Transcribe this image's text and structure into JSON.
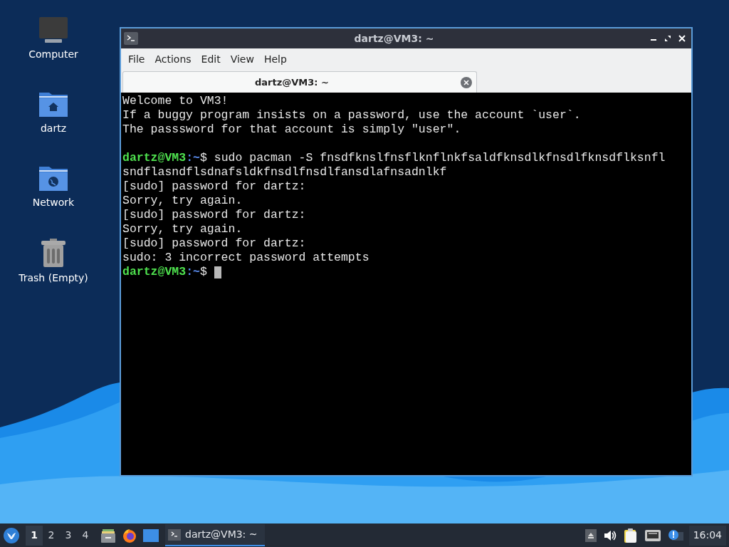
{
  "desktop_icons": [
    {
      "kind": "computer",
      "label": "Computer"
    },
    {
      "kind": "home",
      "label": "dartz"
    },
    {
      "kind": "network",
      "label": "Network"
    },
    {
      "kind": "trash",
      "label": "Trash (Empty)"
    }
  ],
  "window": {
    "title": "dartz@VM3: ~",
    "active": true,
    "menu": [
      "File",
      "Actions",
      "Edit",
      "View",
      "Help"
    ],
    "tabs": [
      {
        "label": "dartz@VM3: ~",
        "selected": true
      }
    ],
    "terminal": [
      {
        "kind": "output",
        "text": "Welcome to VM3!"
      },
      {
        "kind": "output",
        "text": "If a buggy program insists on a password, use the account `user`."
      },
      {
        "kind": "output",
        "text": "The passsword for that account is simply \"user\"."
      },
      {
        "kind": "blank"
      },
      {
        "kind": "prompt",
        "user": "dartz@VM3",
        "path": ":~",
        "command": "$ sudo pacman -S fnsdfknslfnsflknflnkfsaldfknsdlkfnsdlfknsdflksnfl",
        "cursor": false
      },
      {
        "kind": "output",
        "text": "sndflasndflsdnafsldkfnsdlfnsdlfansdlafnsadnlkf"
      },
      {
        "kind": "output",
        "text": "[sudo] password for dartz:"
      },
      {
        "kind": "output",
        "text": "Sorry, try again."
      },
      {
        "kind": "output",
        "text": "[sudo] password for dartz:"
      },
      {
        "kind": "output",
        "text": "Sorry, try again."
      },
      {
        "kind": "output",
        "text": "[sudo] password for dartz:"
      },
      {
        "kind": "output",
        "text": "sudo: 3 incorrect password attempts"
      },
      {
        "kind": "prompt",
        "user": "dartz@VM3",
        "path": ":~",
        "command": "$ ",
        "cursor": true
      }
    ]
  },
  "taskbar": {
    "workspaces": [
      {
        "label": "1",
        "selected": true
      },
      {
        "label": "2",
        "selected": false
      },
      {
        "label": "3",
        "selected": false
      },
      {
        "label": "4",
        "selected": false
      }
    ],
    "launchers": [
      {
        "kind": "files"
      },
      {
        "kind": "browser"
      },
      {
        "kind": "desktop"
      }
    ],
    "tasks": [
      {
        "label": "dartz@VM3: ~",
        "selected": true
      }
    ],
    "tray": [
      {
        "kind": "eject"
      },
      {
        "kind": "volume"
      },
      {
        "kind": "clipboard"
      },
      {
        "kind": "network"
      },
      {
        "kind": "notification"
      }
    ],
    "clock": "16:04"
  }
}
